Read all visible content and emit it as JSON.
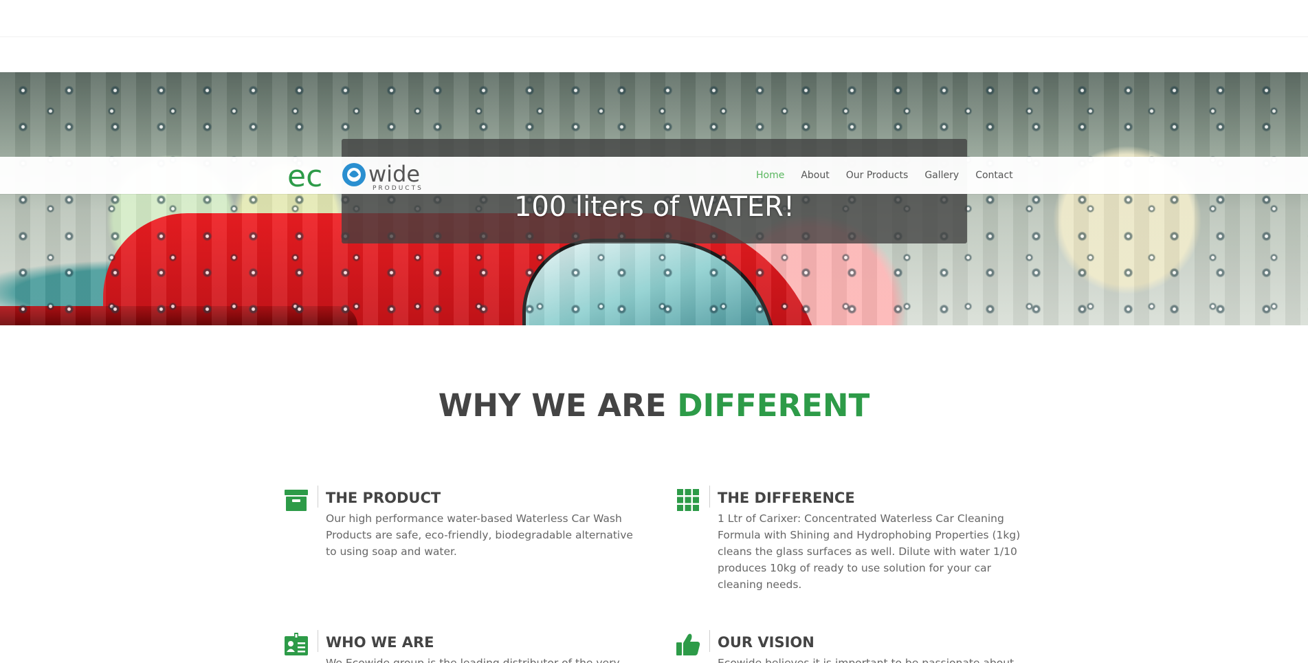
{
  "hero": {
    "headline": "100 liters of WATER!"
  },
  "header": {
    "logo": {
      "text_eco": "ec",
      "text_wide": "wide",
      "text_tagline": "PRODUCTS",
      "brand_green": "#2d9b48",
      "brand_blue": "#2a8fd0",
      "text_gray": "#555555"
    },
    "nav": [
      {
        "label": "Home",
        "active": true
      },
      {
        "label": "About",
        "active": false
      },
      {
        "label": "Our Products",
        "active": false
      },
      {
        "label": "Gallery",
        "active": false
      },
      {
        "label": "Contact",
        "active": false
      }
    ]
  },
  "section": {
    "title_part1": "WHY WE ARE",
    "title_part2": "DIFFERENT",
    "accent_color": "#2d9b48"
  },
  "features": [
    {
      "icon": "archive-icon",
      "title": "THE PRODUCT",
      "text": "Our high performance water-based Waterless Car Wash Products are safe, eco-friendly, biodegradable alternative to using soap and water."
    },
    {
      "icon": "grid-icon",
      "title": "THE DIFFERENCE",
      "text": "1 Ltr of Carixer: Concentrated Waterless Car Cleaning Formula with Shining and Hydrophobing Properties (1kg) cleans the glass surfaces as well. Dilute with water 1/10 produces 10kg of ready to use solution for your car cleaning needs."
    },
    {
      "icon": "id-card-icon",
      "title": "WHO WE ARE",
      "text": "We Ecowide group is the leading distributor of the very best"
    },
    {
      "icon": "thumbs-up-icon",
      "title": "OUR VISION",
      "text": "Ecowide believes it is important to be passionate about"
    }
  ]
}
